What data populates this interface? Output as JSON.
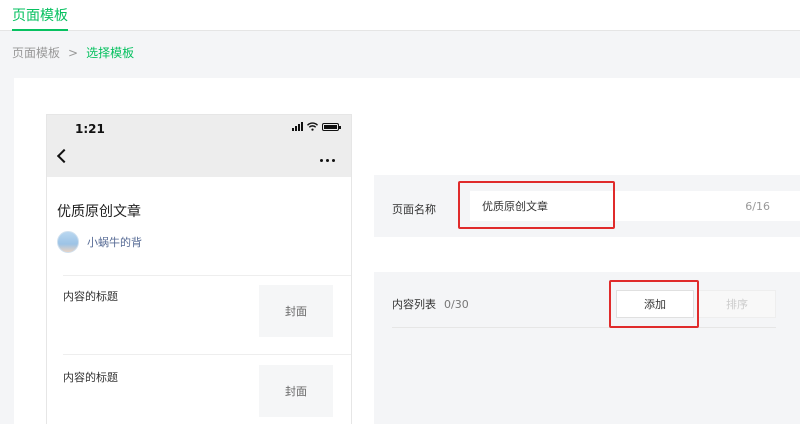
{
  "top_tab": {
    "label": "页面模板"
  },
  "breadcrumb": {
    "parent": "页面模板",
    "separator": ">",
    "current": "选择模板"
  },
  "phone": {
    "time": "1:21",
    "article_title": "优质原创文章",
    "author": "小蜗牛的背",
    "items": [
      {
        "title": "内容的标题",
        "cover": "封面"
      },
      {
        "title": "内容的标题",
        "cover": "封面"
      }
    ]
  },
  "page_name": {
    "label": "页面名称",
    "value": "优质原创文章",
    "counter": "6/16"
  },
  "content_list": {
    "label": "内容列表",
    "count": "0/30",
    "add_label": "添加",
    "sort_label": "排序"
  },
  "colors": {
    "accent": "#07c160",
    "highlight": "#e02b2b",
    "link": "#576b95"
  }
}
